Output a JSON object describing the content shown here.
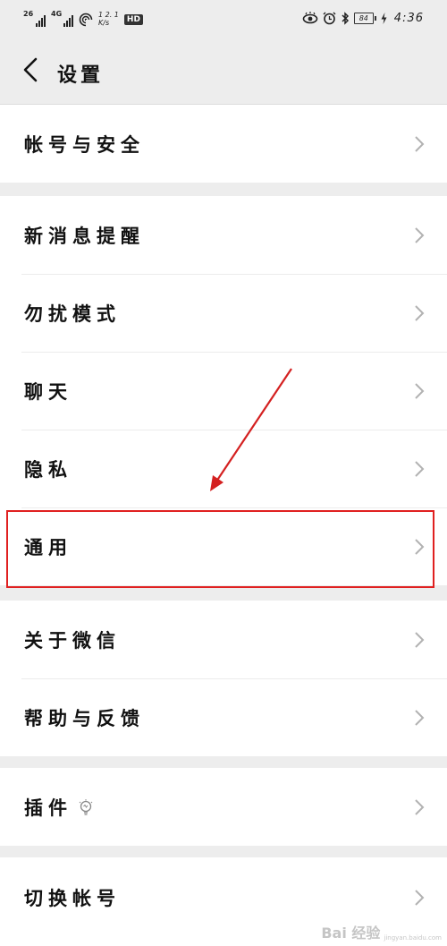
{
  "status_bar": {
    "sim1": "26",
    "sim2": "4G",
    "speed_top": "1 2. 1",
    "speed_bottom": "K/s",
    "hd": "HD",
    "battery": "84",
    "time": "4:36"
  },
  "header": {
    "title": "设置"
  },
  "groups": [
    {
      "items": [
        {
          "label": "帐号与安全"
        }
      ]
    },
    {
      "items": [
        {
          "label": "新消息提醒"
        },
        {
          "label": "勿扰模式"
        },
        {
          "label": "聊天"
        },
        {
          "label": "隐私"
        },
        {
          "label": "通用"
        }
      ]
    },
    {
      "items": [
        {
          "label": "关于微信"
        },
        {
          "label": "帮助与反馈"
        }
      ]
    },
    {
      "items": [
        {
          "label": "插件"
        }
      ]
    },
    {
      "items": [
        {
          "label": "切换帐号"
        }
      ]
    }
  ],
  "colors": {
    "background": "#ededed",
    "card": "#ffffff",
    "highlight": "#e02020",
    "chevron": "#b2b2b2"
  },
  "watermark": {
    "brand": "Bai 经验",
    "url": "jingyan.baidu.com"
  }
}
